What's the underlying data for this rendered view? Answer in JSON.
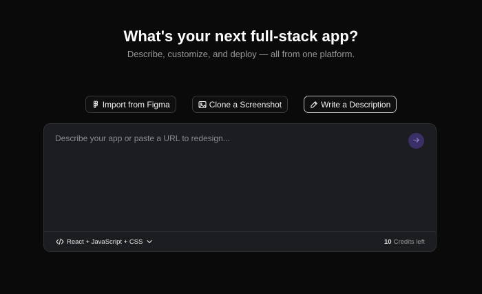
{
  "hero": {
    "title": "What's your next full-stack app?",
    "subtitle": "Describe, customize, and deploy — all from one platform."
  },
  "modes": [
    {
      "label": "Import from Figma",
      "icon": "figma-icon",
      "active": false
    },
    {
      "label": "Clone a Screenshot",
      "icon": "image-icon",
      "active": false
    },
    {
      "label": "Write a Description",
      "icon": "pencil-icon",
      "active": true
    }
  ],
  "prompt": {
    "value": "",
    "placeholder": "Describe your app or paste a URL to redesign..."
  },
  "submit": {
    "icon": "arrow-right-icon"
  },
  "footer": {
    "stack_label": "React + JavaScript + CSS",
    "stack_icon": "code-icon",
    "credits_count": "10",
    "credits_label": "Credits left"
  },
  "colors": {
    "background": "#0a0a0a",
    "card": "#1c1d20",
    "accent": "#3a2f66"
  }
}
